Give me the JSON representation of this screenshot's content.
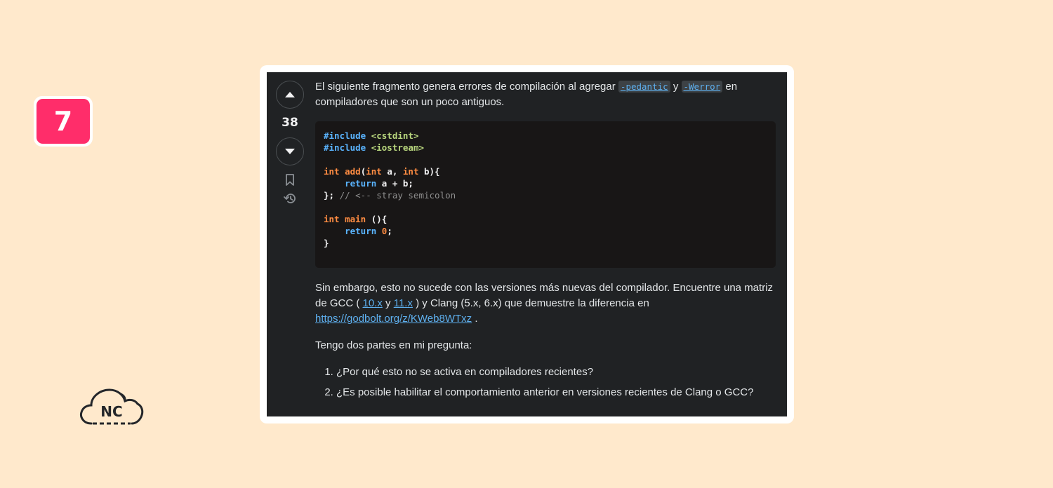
{
  "badge": {
    "number": "7"
  },
  "logo": {
    "text": "NC"
  },
  "vote": {
    "count": "38"
  },
  "post": {
    "intro_before": "El siguiente fragmento genera errores de compilación al agregar ",
    "flag1": "-pedantic",
    "intro_mid": "y",
    "flag2": "-Werror",
    "intro_after": "en compiladores que son un poco antiguos.",
    "code": [
      {
        "tokens": [
          {
            "t": "#include ",
            "c": "pp"
          },
          {
            "t": "<cstdint>",
            "c": "str"
          }
        ]
      },
      {
        "tokens": [
          {
            "t": "#include ",
            "c": "pp"
          },
          {
            "t": "<iostream>",
            "c": "str"
          }
        ]
      },
      {
        "tokens": []
      },
      {
        "tokens": [
          {
            "t": "int",
            "c": "kw"
          },
          {
            "t": " ",
            "c": ""
          },
          {
            "t": "add",
            "c": "fn"
          },
          {
            "t": "(",
            "c": ""
          },
          {
            "t": "int",
            "c": "kw"
          },
          {
            "t": " a, ",
            "c": ""
          },
          {
            "t": "int",
            "c": "kw"
          },
          {
            "t": " b){",
            "c": ""
          }
        ]
      },
      {
        "tokens": [
          {
            "t": "    ",
            "c": ""
          },
          {
            "t": "return",
            "c": "kw2"
          },
          {
            "t": " a + b;",
            "c": ""
          }
        ]
      },
      {
        "tokens": [
          {
            "t": "}; ",
            "c": ""
          },
          {
            "t": "// <-- stray semicolon",
            "c": "cm"
          }
        ]
      },
      {
        "tokens": []
      },
      {
        "tokens": [
          {
            "t": "int",
            "c": "kw"
          },
          {
            "t": " ",
            "c": ""
          },
          {
            "t": "main",
            "c": "fn"
          },
          {
            "t": " (){",
            "c": ""
          }
        ]
      },
      {
        "tokens": [
          {
            "t": "    ",
            "c": ""
          },
          {
            "t": "return",
            "c": "kw2"
          },
          {
            "t": " ",
            "c": ""
          },
          {
            "t": "0",
            "c": "num"
          },
          {
            "t": ";",
            "c": ""
          }
        ]
      },
      {
        "tokens": [
          {
            "t": "}",
            "c": ""
          }
        ]
      }
    ],
    "para2_a": "Sin embargo, esto no sucede con las versiones más nuevas del compilador. Encuentre una matriz de GCC ( ",
    "link_10x": "10.x",
    "para2_b": " y ",
    "link_11x": "11.x",
    "para2_c": " ) y Clang (5.x, 6.x) que demuestre la diferencia en ",
    "link_godbolt": "https://godbolt.org/z/KWeb8WTxz",
    "para2_d": " .",
    "para3": "Tengo dos partes en mi pregunta:",
    "questions": [
      "¿Por qué esto no se activa en compiladores recientes?",
      "¿Es posible habilitar el comportamiento anterior en versiones recientes de Clang o GCC?"
    ]
  },
  "colors": {
    "background": "#ffe9cc",
    "badge": "#ff2d6a",
    "card": "#202224",
    "code_bg": "#181616",
    "link": "#5eb0ef"
  }
}
